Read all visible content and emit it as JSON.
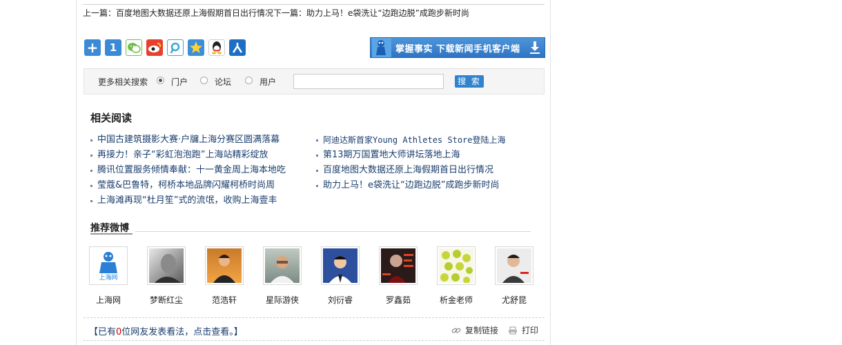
{
  "prev_next": "上一篇：百度地图大数据还原上海假期首日出行情况下一篇：助力上马！e袋洗让“边跑边脱”成跑步新时尚",
  "share_icons": [
    "more-share-icon",
    "share-1-icon",
    "wechat-icon",
    "sina-weibo-icon",
    "tencent-weibo-icon",
    "qzone-icon",
    "qq-icon",
    "renren-icon"
  ],
  "download_banner": {
    "text": "掌握事实  下载新闻手机客户端"
  },
  "search": {
    "label": "更多相关搜索",
    "options": [
      "门户",
      "论坛",
      "用户"
    ],
    "selected": "门户",
    "input_value": "",
    "button": "搜 索"
  },
  "related": {
    "title": "相关阅读",
    "left": [
      "中国古建筑摄影大赛·户牖上海分赛区圆满落幕",
      "再接力！亲子“彩虹泡泡跑”上海站精彩绽放",
      "腾讯位置服务倾情奉献：十一黄金周上海本地吃",
      "莹蔻&巴鲁特，柯桥本地品牌闪耀柯桥时尚周",
      "上海滩再现“杜月笙”式的流氓，收购上海壹丰"
    ],
    "right": [
      "阿迪达斯首家Young Athletes Store登陆上海",
      "第13期万国置地大师讲坛落地上海",
      "百度地图大数据还原上海假期首日出行情况",
      "助力上马！e袋洗让“边跑边脱”成跑步新时尚"
    ]
  },
  "weibo": {
    "title": "推荐微博",
    "accounts": [
      "上海网",
      "梦断红尘",
      "范浩轩",
      "星际游侠",
      "刘衍睿",
      "罗鑫茹",
      "析金老师",
      "尤舒昆"
    ],
    "logo_text": "上海网"
  },
  "comments": {
    "prefix": "【已有",
    "count": "0",
    "suffix": "位网友发表看法，点击查看。】"
  },
  "tools": {
    "copy": "复制链接",
    "print": "打印"
  },
  "colors": {
    "link": "#1a3d6d",
    "accent": "#2f83cf",
    "count": "#cc0000"
  }
}
